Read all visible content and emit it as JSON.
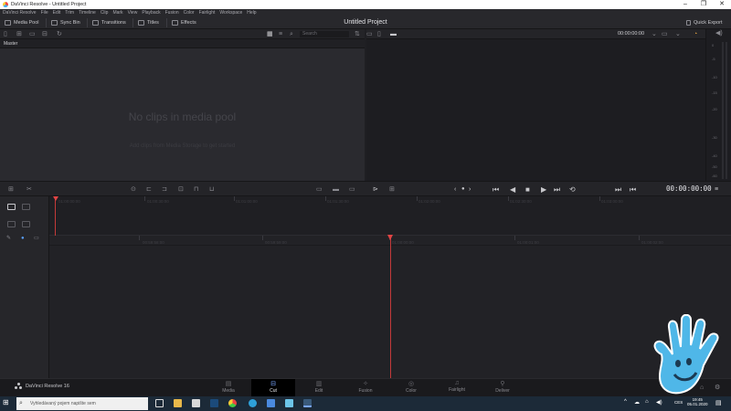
{
  "window": {
    "title": "DaVinci Resolve - Untitled Project",
    "minimize": "–",
    "maximize": "❐",
    "close": "✕"
  },
  "menu": [
    "DaVinci Resolve",
    "File",
    "Edit",
    "Trim",
    "Timeline",
    "Clip",
    "Mark",
    "View",
    "Playback",
    "Fusion",
    "Color",
    "Fairlight",
    "Workspace",
    "Help"
  ],
  "toolbar": {
    "media_pool": "Media Pool",
    "sync_bin": "Sync Bin",
    "transitions": "Transitions",
    "titles": "Titles",
    "effects": "Effects",
    "project_title": "Untitled Project",
    "quick_export": "Quick Export"
  },
  "media_pool": {
    "search_placeholder": "Search",
    "bin": "Master",
    "empty_title": "No clips in media pool",
    "empty_subtitle": "Add clips from Media Storage to get started"
  },
  "viewer": {
    "timecode_top": "00:00:00:00",
    "timecode": "00:00:00:00"
  },
  "audio_meter": {
    "labels": [
      "0",
      "-5",
      "-10",
      "-15",
      "-20",
      "-30",
      "-40",
      "-50",
      "-60"
    ]
  },
  "timeline": {
    "upper_ruler": [
      "01:00:00:00",
      "01:00:30:00",
      "01:01:00:00",
      "01:01:30:00",
      "01:02:00:00",
      "01:02:30:00",
      "01:03:00:00"
    ],
    "lower_ruler": [
      "00:59:58:00",
      "00:59:59:00",
      "01:00:00:00",
      "01:00:01:00",
      "01:00:02:00",
      "01:00:03:00"
    ]
  },
  "pages": {
    "brand": "DaVinci Resolve 16",
    "tabs": [
      {
        "label": "Media",
        "icon": "media-icon"
      },
      {
        "label": "Cut",
        "icon": "cut-icon"
      },
      {
        "label": "Edit",
        "icon": "edit-icon"
      },
      {
        "label": "Fusion",
        "icon": "fusion-icon"
      },
      {
        "label": "Color",
        "icon": "color-icon"
      },
      {
        "label": "Fairlight",
        "icon": "fairlight-icon"
      },
      {
        "label": "Deliver",
        "icon": "deliver-icon"
      }
    ],
    "active": "Cut"
  },
  "taskbar": {
    "search_placeholder": "Vyhledávaný pojem napište sem",
    "lang": "CES",
    "time": "19:45",
    "date": "05.01.2020"
  },
  "colors": {
    "accent": "#e04444",
    "active_page_icon": "#7aa7ff",
    "taskbar": "#1c2a38",
    "watermark_hand": "#4fb7e8"
  }
}
